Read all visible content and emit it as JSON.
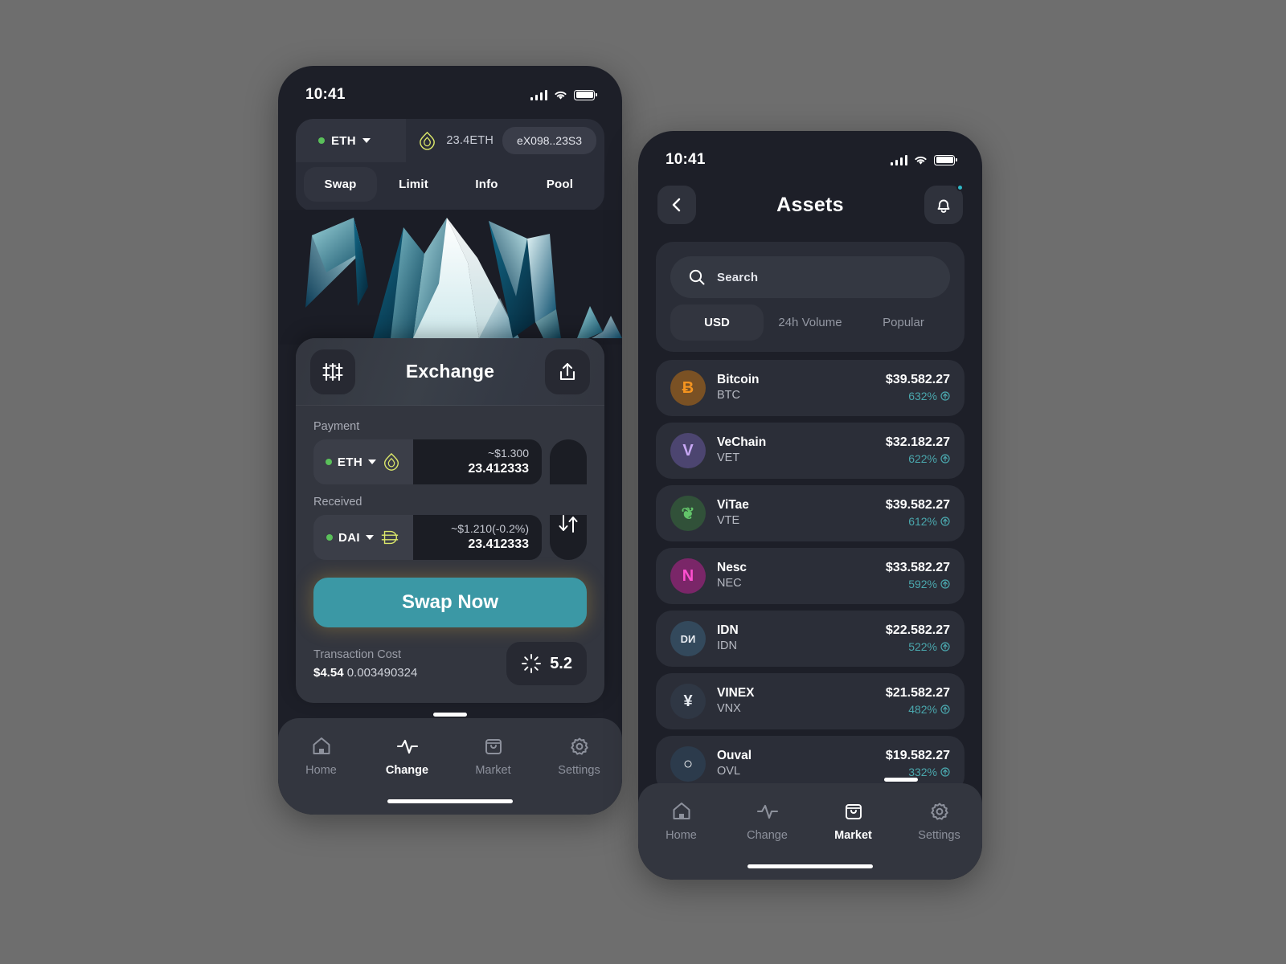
{
  "swap_screen": {
    "status": {
      "time": "10:41",
      "signal_icon": "signal-bars-icon",
      "wifi_icon": "wifi-icon",
      "battery_icon": "battery-icon"
    },
    "wallet": {
      "network": "ETH",
      "network_dot_color": "#5ac05a",
      "token_icon": "ethereum-diamond-icon",
      "balance": "23.4ETH",
      "address": "eX098..23S3"
    },
    "tabs": [
      {
        "label": "Swap",
        "active": true
      },
      {
        "label": "Limit",
        "active": false
      },
      {
        "label": "Info",
        "active": false
      },
      {
        "label": "Pool",
        "active": false
      }
    ],
    "exchange": {
      "title": "Exchange",
      "settings_icon": "sliders-icon",
      "share_icon": "share-upload-icon",
      "payment_label": "Payment",
      "payment": {
        "coin": "ETH",
        "coin_icon": "ethereum-diamond-icon",
        "usd": "~$1.300",
        "amount": "23.412333"
      },
      "received_label": "Received",
      "received": {
        "coin": "DAI",
        "coin_icon": "dai-icon",
        "usd": "~$1.210(-0.2%)",
        "amount": "23.412333"
      },
      "flip_icon": "swap-vertical-arrows-icon",
      "swap_button": "Swap Now",
      "swap_button_color": "#3b98a5",
      "cost_label": "Transaction Cost",
      "cost_usd": "$4.54",
      "cost_crypto": "0.003490324",
      "gas_icon": "gas-burst-icon",
      "gas_value": "5.2"
    },
    "nav": [
      {
        "label": "Home",
        "icon": "home-icon",
        "active": false
      },
      {
        "label": "Change",
        "icon": "activity-pulse-icon",
        "active": true
      },
      {
        "label": "Market",
        "icon": "shopping-bag-icon",
        "active": false
      },
      {
        "label": "Settings",
        "icon": "gear-icon",
        "active": false
      }
    ]
  },
  "assets_screen": {
    "status": {
      "time": "10:41",
      "signal_icon": "signal-bars-icon",
      "wifi_icon": "wifi-icon",
      "battery_icon": "battery-icon"
    },
    "header": {
      "back_icon": "chevron-left-icon",
      "title": "Assets",
      "bell_icon": "bell-icon",
      "badge_color": "#2fb8c6"
    },
    "search": {
      "placeholder": "Search",
      "icon": "search-icon"
    },
    "filters": [
      {
        "label": "USD",
        "active": true
      },
      {
        "label": "24h Volume",
        "active": false
      },
      {
        "label": "Popular",
        "active": false
      }
    ],
    "assets": [
      {
        "name": "Bitcoin",
        "ticker": "BTC",
        "price": "$39.582.27",
        "change": "632%",
        "icon": "bitcoin-icon",
        "bg": "#7a5124",
        "fg": "#f5941f",
        "glyph": "Ƀ"
      },
      {
        "name": "VeChain",
        "ticker": "VET",
        "price": "$32.182.27",
        "change": "622%",
        "icon": "vechain-icon",
        "bg": "#4c4570",
        "fg": "#c8a8f5",
        "glyph": "V"
      },
      {
        "name": "ViTae",
        "ticker": "VTE",
        "price": "$39.582.27",
        "change": "612%",
        "icon": "vitae-leaf-icon",
        "bg": "#315139",
        "fg": "#63c46a",
        "glyph": "❦"
      },
      {
        "name": "Nesc",
        "ticker": "NEC",
        "price": "$33.582.27",
        "change": "592%",
        "icon": "nesc-icon",
        "bg": "#7a2668",
        "fg": "#ff4fd0",
        "glyph": "N"
      },
      {
        "name": "IDN",
        "ticker": "IDN",
        "price": "$22.582.27",
        "change": "522%",
        "icon": "idn-icon",
        "bg": "#33495c",
        "fg": "#e8ecf2",
        "glyph": "DИ"
      },
      {
        "name": "VINEX",
        "ticker": "VNX",
        "price": "$21.582.27",
        "change": "482%",
        "icon": "vinex-icon",
        "bg": "#2f3744",
        "fg": "#e8ecf2",
        "glyph": "¥"
      },
      {
        "name": "Ouval",
        "ticker": "OVL",
        "price": "$19.582.27",
        "change": "332%",
        "icon": "ouval-ring-icon",
        "bg": "#2c3b4c",
        "fg": "#ffffff",
        "glyph": "○"
      }
    ],
    "change_color": "#4aa7ad",
    "nav": [
      {
        "label": "Home",
        "icon": "home-icon",
        "active": false
      },
      {
        "label": "Change",
        "icon": "activity-pulse-icon",
        "active": false
      },
      {
        "label": "Market",
        "icon": "shopping-bag-icon",
        "active": true
      },
      {
        "label": "Settings",
        "icon": "gear-icon",
        "active": false
      }
    ]
  }
}
